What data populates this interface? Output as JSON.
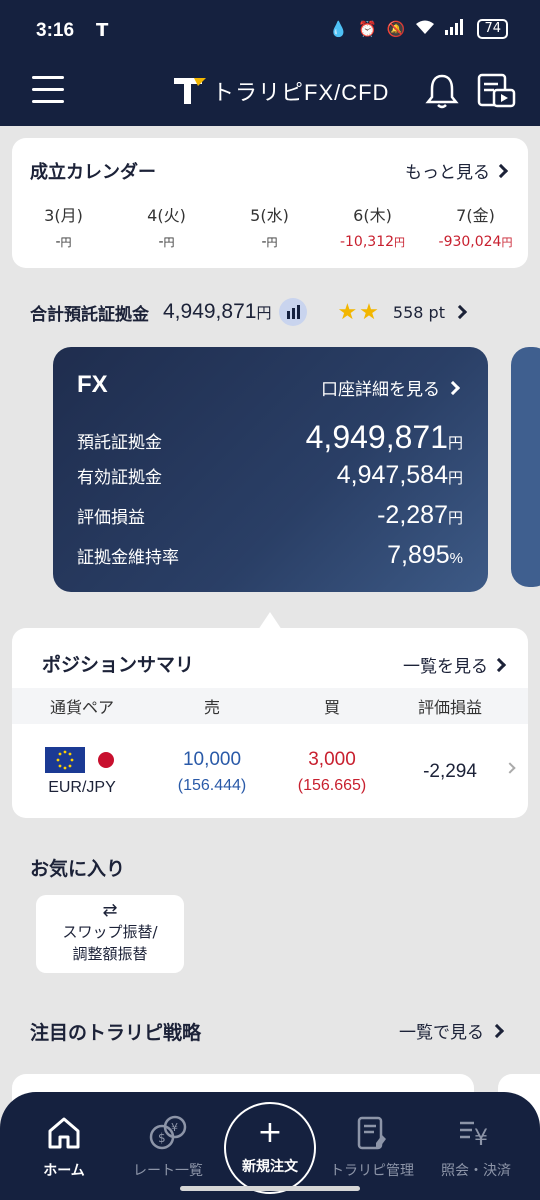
{
  "status_bar": {
    "time": "3:16",
    "app_glyph": "T",
    "battery": "74"
  },
  "header": {
    "brand": "トラリピFX/CFD"
  },
  "calendar": {
    "title": "成立カレンダー",
    "more": "もっと見る",
    "days": [
      {
        "day": "3(月)",
        "value": "-",
        "unit": "円",
        "negative": false
      },
      {
        "day": "4(火)",
        "value": "-",
        "unit": "円",
        "negative": false
      },
      {
        "day": "5(水)",
        "value": "-",
        "unit": "円",
        "negative": false
      },
      {
        "day": "6(木)",
        "value": "-10,312",
        "unit": "円",
        "negative": true
      },
      {
        "day": "7(金)",
        "value": "-930,024",
        "unit": "円",
        "negative": true
      }
    ]
  },
  "summary": {
    "label": "合計預託証拠金",
    "value": "4,949,871",
    "unit": "円",
    "points": "558 pt"
  },
  "fx": {
    "title": "FX",
    "detail": "口座詳細を見る",
    "rows": [
      {
        "label": "預託証拠金",
        "value": "4,949,871",
        "unit": "円"
      },
      {
        "label": "有効証拠金",
        "value": "4,947,584",
        "unit": "円"
      },
      {
        "label": "評価損益",
        "value": "-2,287",
        "unit": "円"
      },
      {
        "label": "証拠金維持率",
        "value": "7,895",
        "unit": "%"
      }
    ]
  },
  "positions": {
    "title": "ポジションサマリ",
    "more": "一覧を見る",
    "headers": {
      "pair": "通貨ペア",
      "sell": "売",
      "buy": "買",
      "pl": "評価損益"
    },
    "row": {
      "pair": "EUR/JPY",
      "sell_amount": "10,000",
      "sell_price": "(156.444)",
      "buy_amount": "3,000",
      "buy_price": "(156.665)",
      "pl": "-2,294"
    }
  },
  "favorites": {
    "title": "お気に入り",
    "button_line1": "スワップ振替/",
    "button_line2": "調整額振替"
  },
  "strategy": {
    "title": "注目のトラリピ戦略",
    "more": "一覧で見る"
  },
  "nav": {
    "home": "ホーム",
    "rates": "レート一覧",
    "new_order": "新規注文",
    "manage": "トラリピ管理",
    "inquiry": "照会・決済"
  },
  "colors": {
    "navy": "#15213f",
    "negative": "#c8202f",
    "sell": "#2a5aa8",
    "star": "#f2b600"
  }
}
